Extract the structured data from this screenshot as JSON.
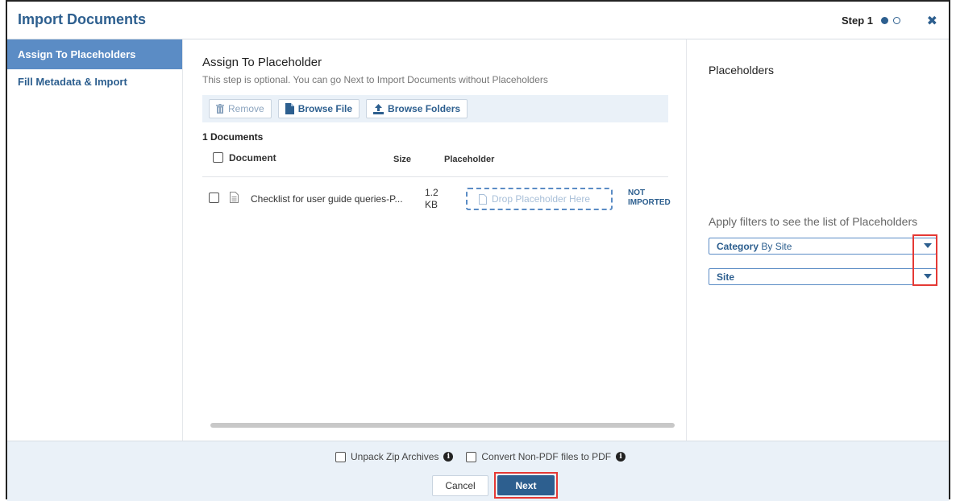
{
  "header": {
    "title": "Import Documents",
    "step_label": "Step 1"
  },
  "sidebar": {
    "items": [
      {
        "label": "Assign To Placeholders",
        "active": true
      },
      {
        "label": "Fill Metadata & Import",
        "active": false
      }
    ]
  },
  "main": {
    "title": "Assign To Placeholder",
    "subtitle": "This step is optional. You can go Next to Import Documents without Placeholders",
    "toolbar": {
      "remove_label": "Remove",
      "browse_file_label": "Browse File",
      "browse_folders_label": "Browse Folders"
    },
    "doc_count": "1 Documents",
    "columns": {
      "document": "Document",
      "size": "Size",
      "placeholder": "Placeholder"
    },
    "rows": [
      {
        "name": "Checklist for user guide queries-P...",
        "size_value": "1.2",
        "size_unit": "KB",
        "drop_label": "Drop Placeholder Here",
        "status_line1": "NOT",
        "status_line2": "IMPORTED"
      }
    ]
  },
  "right": {
    "title": "Placeholders",
    "hint": "Apply filters to see the list of Placeholders",
    "category": {
      "label": "Category",
      "value": "By Site"
    },
    "site": {
      "label": "Site",
      "value": ""
    }
  },
  "footer": {
    "unpack_label": "Unpack Zip Archives",
    "convert_label": "Convert Non-PDF files to PDF",
    "cancel_label": "Cancel",
    "next_label": "Next"
  },
  "colors": {
    "accent": "#2d5f8f",
    "sidebar_active": "#5b8cc5",
    "highlight": "#e53935",
    "footer_bg": "#eaf1f8"
  }
}
